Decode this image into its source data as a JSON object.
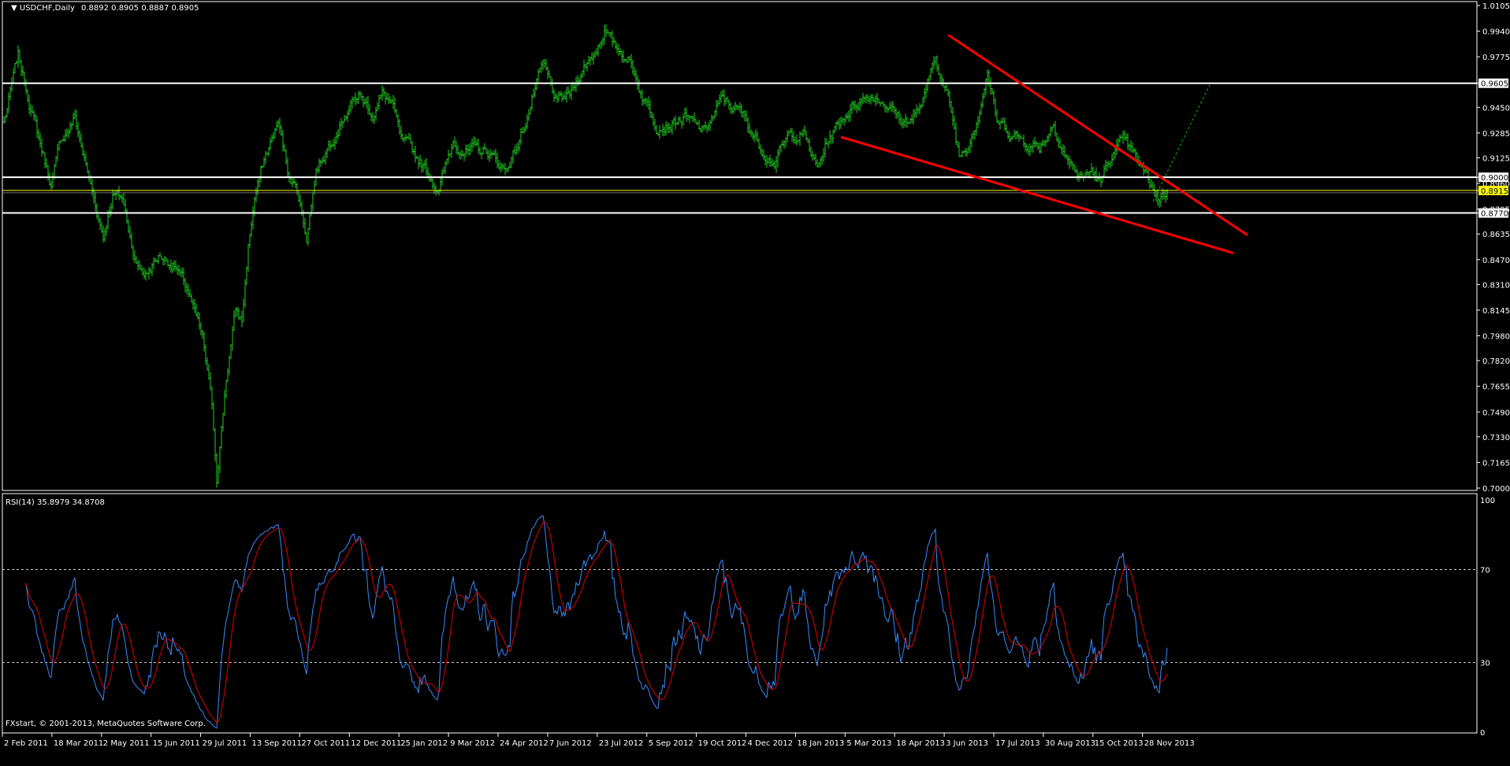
{
  "header": {
    "symbol": "USDCHF,Daily",
    "ohlc": "0.8892 0.8905 0.8887 0.8905"
  },
  "rsi_header": {
    "label": "RSI(14) 35.8979 34.8708"
  },
  "copyright": "FXstart, © 2001-2013, MetaQuotes Software Corp.",
  "colors": {
    "bars": "#1fd01f",
    "trend": "#ff0000",
    "rsi": "#3a8cff",
    "rsi_signal": "#e00000",
    "level": "#ffffff",
    "bid": "#ffff00",
    "forecast": "#00c000"
  },
  "chart_data": [
    {
      "type": "ohlc",
      "title": "USDCHF,Daily",
      "ylim": [
        0.7,
        1.0105
      ],
      "y_ticks": [
        "1.0105",
        "0.9940",
        "0.9775",
        "0.9605",
        "0.9450",
        "0.9285",
        "0.9125",
        "0.9000",
        "0.8960",
        "0.8915",
        "0.8795",
        "0.8770",
        "0.8635",
        "0.8470",
        "0.8310",
        "0.8145",
        "0.7980",
        "0.7820",
        "0.7655",
        "0.7490",
        "0.7330",
        "0.7165",
        "0.7000"
      ],
      "x_ticks": [
        "2 Feb 2011",
        "18 Mar 2011",
        "2 May 2011",
        "15 Jun 2011",
        "29 Jul 2011",
        "13 Sep 2011",
        "27 Oct 2011",
        "12 Dec 2011",
        "25 Jan 2012",
        "9 Mar 2012",
        "24 Apr 2012",
        "7 Jun 2012",
        "23 Jul 2012",
        "5 Sep 2012",
        "19 Oct 2012",
        "4 Dec 2012",
        "18 Jan 2013",
        "5 Mar 2013",
        "18 Apr 2013",
        "3 Jun 2013",
        "17 Jul 2013",
        "30 Aug 2013",
        "15 Oct 2013",
        "28 Nov 2013"
      ],
      "close_waypoints_day_price": [
        [
          0,
          0.935
        ],
        [
          9,
          0.9776
        ],
        [
          15,
          0.9533
        ],
        [
          21,
          0.929
        ],
        [
          30,
          0.8955
        ],
        [
          36,
          0.9229
        ],
        [
          45,
          0.9381
        ],
        [
          54,
          0.8986
        ],
        [
          63,
          0.8621
        ],
        [
          69,
          0.8895
        ],
        [
          75,
          0.8864
        ],
        [
          84,
          0.8439
        ],
        [
          90,
          0.8378
        ],
        [
          99,
          0.85
        ],
        [
          108,
          0.8439
        ],
        [
          117,
          0.8256
        ],
        [
          126,
          0.7952
        ],
        [
          132,
          0.7527
        ],
        [
          135,
          0.7071
        ],
        [
          141,
          0.7709
        ],
        [
          147,
          0.8135
        ],
        [
          151,
          0.8074
        ],
        [
          155,
          0.856
        ],
        [
          159,
          0.8864
        ],
        [
          165,
          0.9107
        ],
        [
          174,
          0.935
        ],
        [
          180,
          0.9046
        ],
        [
          186,
          0.8925
        ],
        [
          192,
          0.8621
        ],
        [
          198,
          0.9046
        ],
        [
          207,
          0.9229
        ],
        [
          216,
          0.9411
        ],
        [
          225,
          0.9533
        ],
        [
          234,
          0.9411
        ],
        [
          240,
          0.9533
        ],
        [
          246,
          0.9472
        ],
        [
          252,
          0.9229
        ],
        [
          264,
          0.9107
        ],
        [
          276,
          0.8925
        ],
        [
          285,
          0.9229
        ],
        [
          294,
          0.9168
        ],
        [
          306,
          0.9168
        ],
        [
          318,
          0.9046
        ],
        [
          327,
          0.9229
        ],
        [
          336,
          0.9533
        ],
        [
          342,
          0.9715
        ],
        [
          351,
          0.9472
        ],
        [
          360,
          0.9533
        ],
        [
          366,
          0.9685
        ],
        [
          375,
          0.9806
        ],
        [
          381,
          0.9958
        ],
        [
          387,
          0.9837
        ],
        [
          396,
          0.9776
        ],
        [
          405,
          0.9533
        ],
        [
          414,
          0.935
        ],
        [
          423,
          0.935
        ],
        [
          432,
          0.9381
        ],
        [
          444,
          0.929
        ],
        [
          456,
          0.9502
        ],
        [
          468,
          0.9411
        ],
        [
          480,
          0.9198
        ],
        [
          489,
          0.9107
        ],
        [
          498,
          0.9259
        ],
        [
          507,
          0.929
        ],
        [
          516,
          0.9046
        ],
        [
          522,
          0.9229
        ],
        [
          534,
          0.9411
        ],
        [
          543,
          0.9502
        ],
        [
          552,
          0.9533
        ],
        [
          561,
          0.9472
        ],
        [
          570,
          0.935
        ],
        [
          579,
          0.9411
        ],
        [
          585,
          0.9533
        ],
        [
          591,
          0.9806
        ],
        [
          594,
          0.9654
        ],
        [
          600,
          0.9472
        ],
        [
          606,
          0.9138
        ],
        [
          612,
          0.9229
        ],
        [
          618,
          0.9411
        ],
        [
          624,
          0.9685
        ],
        [
          630,
          0.935
        ],
        [
          639,
          0.929
        ],
        [
          648,
          0.9229
        ],
        [
          657,
          0.9198
        ],
        [
          666,
          0.935
        ],
        [
          675,
          0.9107
        ],
        [
          684,
          0.8986
        ],
        [
          690,
          0.9046
        ],
        [
          696,
          0.8955
        ],
        [
          702,
          0.9138
        ],
        [
          711,
          0.9229
        ],
        [
          720,
          0.9077
        ],
        [
          726,
          0.8986
        ],
        [
          732,
          0.8864
        ],
        [
          738,
          0.8905
        ]
      ],
      "levels": [
        {
          "price": 0.9605,
          "label": "0.9605"
        },
        {
          "price": 0.9,
          "label": "0.9000"
        },
        {
          "price": 0.877,
          "label": "0.8770"
        }
      ],
      "bid": {
        "price": 0.8915,
        "label": "0.8915"
      },
      "trendlines": [
        {
          "name": "upper",
          "from": [
            599,
            0.9916
          ],
          "to": [
            789,
            0.8627
          ]
        },
        {
          "name": "lower",
          "from": [
            531,
            0.9259
          ],
          "to": [
            780,
            0.8512
          ]
        }
      ],
      "forecast": {
        "from": [
          729,
          0.8846
        ],
        "to": [
          765,
          0.9594
        ]
      }
    },
    {
      "type": "line",
      "title": "RSI(14)",
      "values_last": [
        35.8979,
        34.8708
      ],
      "ylim": [
        0,
        100
      ],
      "y_ticks": [
        "100",
        "70",
        "30",
        "0"
      ],
      "levels": [
        70,
        30
      ]
    }
  ]
}
